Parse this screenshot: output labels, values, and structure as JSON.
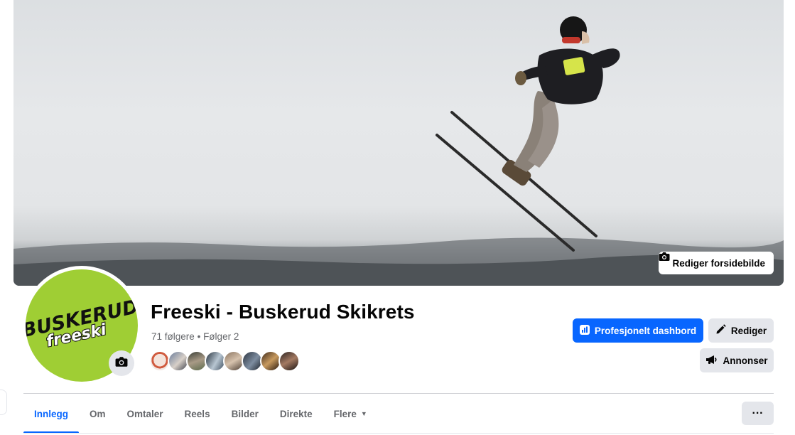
{
  "cover": {
    "edit_label": "Rediger forsidebilde",
    "edit_icon": "camera-icon"
  },
  "avatar": {
    "logo_line1": "BUSKERUD",
    "logo_line2": "freeski",
    "brand_color": "#9fce34",
    "camera_icon": "camera-icon"
  },
  "page": {
    "title": "Freeski - Buskerud Skikrets",
    "followers": "71 følgere",
    "separator": "•",
    "following": "Følger 2"
  },
  "actions": {
    "dashboard_label": "Profesjonelt dashbord",
    "dashboard_icon": "chart-icon",
    "edit_label": "Rediger",
    "edit_icon": "pencil-icon",
    "ads_label": "Annonser",
    "ads_icon": "megaphone-icon",
    "accent_color": "#0866ff"
  },
  "tabs": [
    {
      "label": "Innlegg",
      "active": true
    },
    {
      "label": "Om"
    },
    {
      "label": "Omtaler"
    },
    {
      "label": "Reels"
    },
    {
      "label": "Bilder"
    },
    {
      "label": "Direkte"
    },
    {
      "label": "Flere",
      "dropdown": true
    }
  ],
  "more_label": "···"
}
